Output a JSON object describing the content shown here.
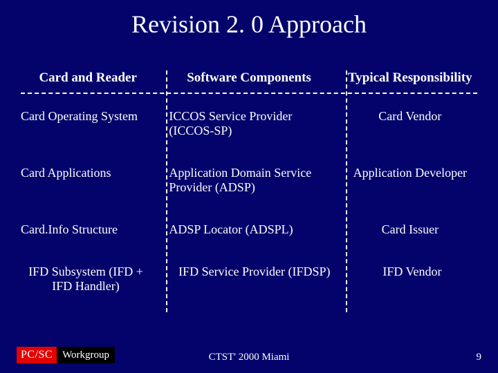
{
  "title": "Revision 2. 0 Approach",
  "chart_data": {
    "type": "table",
    "columns": [
      "Card and Reader",
      "Software Components",
      "Typical Responsibility"
    ],
    "rows": [
      [
        "Card Operating System",
        "ICCOS Service Provider (ICCOS-SP)",
        "Card Vendor"
      ],
      [
        "Card Applications",
        "Application Domain Service Provider (ADSP)",
        "Application Developer"
      ],
      [
        "Card.Info Structure",
        "ADSP Locator (ADSPL)",
        "Card Issuer"
      ],
      [
        "IFD Subsystem (IFD + IFD Handler)",
        "IFD Service Provider (IFDSP)",
        "IFD Vendor"
      ]
    ]
  },
  "logo": {
    "left": "PC/SC",
    "right": "Workgroup"
  },
  "footer": "CTST' 2000 Miami",
  "page": "9"
}
